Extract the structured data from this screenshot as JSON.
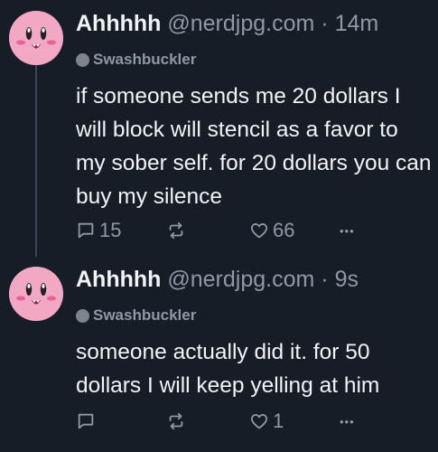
{
  "posts": [
    {
      "author": "Ahhhhh",
      "handle": "@nerdjpg.com",
      "separator": "·",
      "time": "14m",
      "repost_label": "Swashbuckler",
      "text": "if someone sends me 20 dollars I will block will stencil as a favor to my sober self. for 20 dollars you can buy my silence",
      "reply_count": "15",
      "like_count": "66",
      "more": "•••"
    },
    {
      "author": "Ahhhhh",
      "handle": "@nerdjpg.com",
      "separator": "·",
      "time": "9s",
      "repost_label": "Swashbuckler",
      "text": "someone actually did it. for 50 dollars I will keep yelling at him",
      "reply_count": "",
      "like_count": "1",
      "more": "•••"
    }
  ],
  "colors": {
    "background": "#171d26",
    "text": "#f1f3f5",
    "muted": "#8d99a6",
    "avatar_pink": "#f2a7c3",
    "thread_line": "#3c4656"
  },
  "icons": [
    "kirby-avatar",
    "repost-user-icon",
    "reply-icon",
    "repost-icon",
    "like-icon",
    "more-icon"
  ]
}
